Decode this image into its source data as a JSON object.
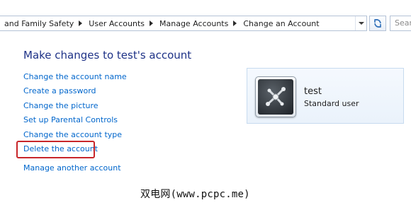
{
  "address_bar": {
    "breadcrumbs": [
      "and Family Safety",
      "User Accounts",
      "Manage Accounts",
      "Change an Account"
    ],
    "search_placeholder": "Search"
  },
  "main": {
    "title": "Make changes to test's account",
    "tasks": [
      {
        "label": "Change the account name"
      },
      {
        "label": "Create a password"
      },
      {
        "label": "Change the picture"
      },
      {
        "label": "Set up Parental Controls"
      },
      {
        "label": "Change the account type"
      },
      {
        "label": "Delete the account"
      },
      {
        "label": "Manage another account"
      }
    ],
    "highlighted_task": "Delete the account"
  },
  "account": {
    "name": "test",
    "type": "Standard user",
    "avatar_icon": "robot-arm-icon"
  },
  "watermark": "双电网(www.pcpc.me)",
  "colors": {
    "link": "#0066cc",
    "title": "#1e3287",
    "highlight": "#c8262a",
    "tile_border": "#c7dbef"
  }
}
